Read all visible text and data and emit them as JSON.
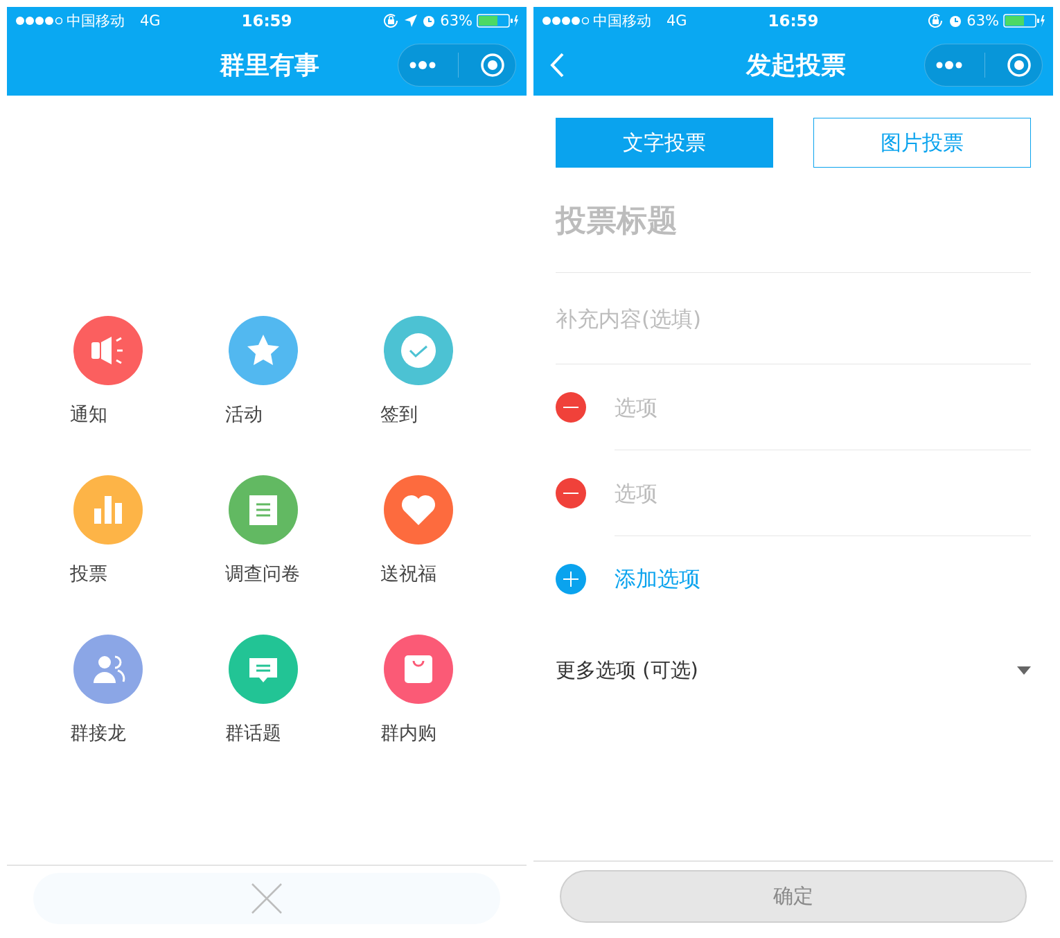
{
  "left": {
    "status_bar": {
      "carrier": "中国移动",
      "network": "4G",
      "time": "16:59",
      "battery": "63%",
      "location": true
    },
    "nav": {
      "title": "群里有事",
      "back": false
    },
    "grid": [
      {
        "label": "通知",
        "color": "#fb5f5f",
        "kind": "speaker"
      },
      {
        "label": "活动",
        "color": "#52b8f0",
        "kind": "star"
      },
      {
        "label": "签到",
        "color": "#4cc2d3",
        "kind": "check"
      },
      {
        "label": "投票",
        "color": "#fdb447",
        "kind": "bars"
      },
      {
        "label": "调查问卷",
        "color": "#62b962",
        "kind": "doc"
      },
      {
        "label": "送祝福",
        "color": "#fd6b3e",
        "kind": "heart"
      },
      {
        "label": "群接龙",
        "color": "#8ba6e6",
        "kind": "people"
      },
      {
        "label": "群话题",
        "color": "#22c495",
        "kind": "chat"
      },
      {
        "label": "群内购",
        "color": "#fb5a76",
        "kind": "bag"
      }
    ],
    "close_button": {
      "kind": "close"
    }
  },
  "right": {
    "status_bar": {
      "carrier": "中国移动",
      "network": "4G",
      "time": "16:59",
      "battery": "63%",
      "location": false
    },
    "nav": {
      "title": "发起投票",
      "back": true
    },
    "tabs": [
      {
        "label": "文字投票",
        "selected": true
      },
      {
        "label": "图片投票",
        "selected": false
      }
    ],
    "title_field": {
      "placeholder": "投票标题"
    },
    "description_field": {
      "placeholder": "补充内容(选填)"
    },
    "options": [
      {
        "placeholder": "选项"
      },
      {
        "placeholder": "选项"
      }
    ],
    "add_option": "添加选项",
    "more_options": {
      "label": "更多选项 (可选)",
      "expanded": false
    },
    "confirm_button": {
      "label": "确定",
      "disabled": true
    }
  }
}
